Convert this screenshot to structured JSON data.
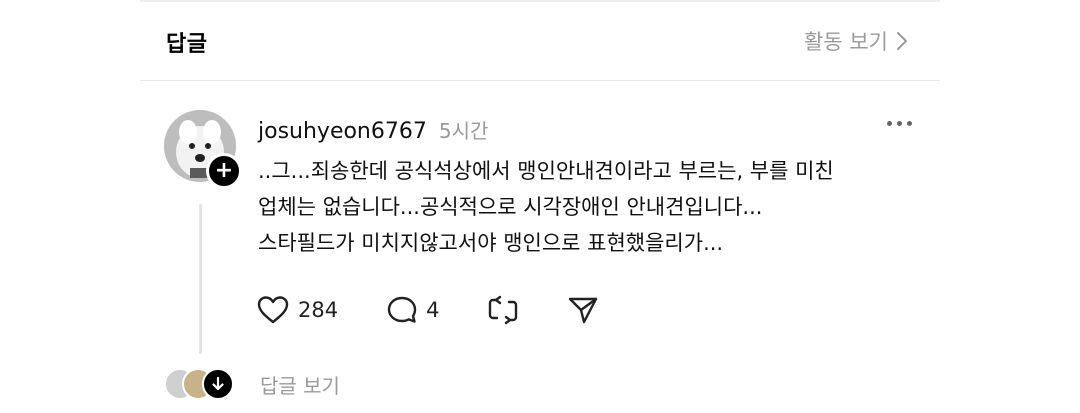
{
  "header": {
    "title": "답글",
    "activity_label": "활동 보기"
  },
  "post": {
    "username": "josuhyeon6767",
    "time": "5시간",
    "body_lines": [
      "..그...죄송한데 공식석상에서 맹인안내견이라고 부르는, 부를 미친",
      "업체는 없습니다...공식적으로 시각장애인 안내견입니다...",
      "스타필드가 미치지않고서야 맹인으로 표현했을리가..."
    ],
    "likes": "284",
    "comments": "4",
    "view_replies_label": "답글 보기"
  },
  "icons": {
    "follow": "plus-icon",
    "more": "more-dots-icon",
    "like": "heart-icon",
    "comment": "comment-bubble-icon",
    "repost": "repost-icon",
    "share": "send-icon",
    "expand_replies": "arrow-down-icon",
    "activity": "chevron-right-icon"
  },
  "colors": {
    "muted_text": "#9a9a9a",
    "divider": "#e8e8e8",
    "thread_line": "#e3e3e3",
    "badge": "#000000"
  }
}
